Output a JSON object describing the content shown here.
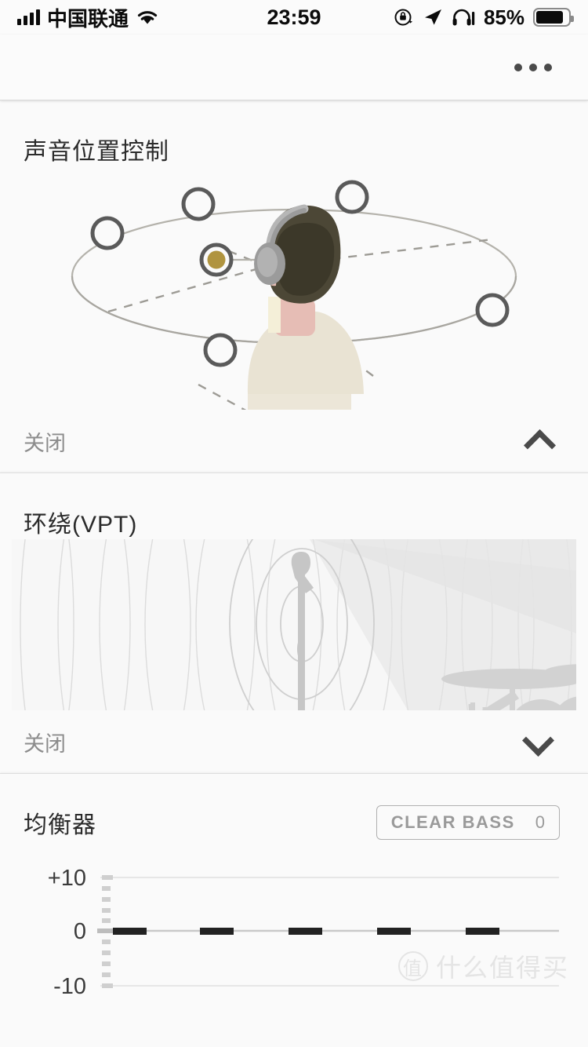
{
  "status_bar": {
    "carrier": "中国联通",
    "time": "23:59",
    "battery_percent": "85%",
    "icons": [
      "signal-bars-icon",
      "wifi-icon",
      "rotation-lock-icon",
      "location-arrow-icon",
      "headphones-icon",
      "battery-icon"
    ]
  },
  "app_header": {
    "menu_label": "more-options"
  },
  "sections": [
    {
      "title": "声音位置控制",
      "status": "关闭",
      "chevron": "chevron-up-icon",
      "expanded": true,
      "illustration": "sound-position-control-illustration"
    },
    {
      "title": "环绕(VPT)",
      "status": "关闭",
      "chevron": "chevron-down-icon",
      "expanded": false,
      "illustration": "vpt-surround-illustration"
    },
    {
      "title": "均衡器",
      "clear_bass_label": "CLEAR BASS",
      "clear_bass_value": "0"
    }
  ],
  "colors": {
    "accent_selected": "#b0943f",
    "ring": "#5a5a5a",
    "text_primary": "#2b2b2b",
    "text_muted": "#8c8c8c",
    "background": "#fafafa",
    "eq_handle": "#222222"
  },
  "chart_data": {
    "type": "bar",
    "title": "均衡器",
    "categories": [
      "band1",
      "band2",
      "band3",
      "band4",
      "band5"
    ],
    "values": [
      0,
      0,
      0,
      0,
      0
    ],
    "ylabel": "",
    "xlabel": "",
    "ylim": [
      -10,
      10
    ],
    "ytick_labels": [
      "+10",
      "0",
      "-10"
    ],
    "ytick_values": [
      10,
      0,
      -10
    ],
    "grid": true,
    "legend": "none"
  },
  "watermark": {
    "badge": "值",
    "text": "什么值得买"
  }
}
